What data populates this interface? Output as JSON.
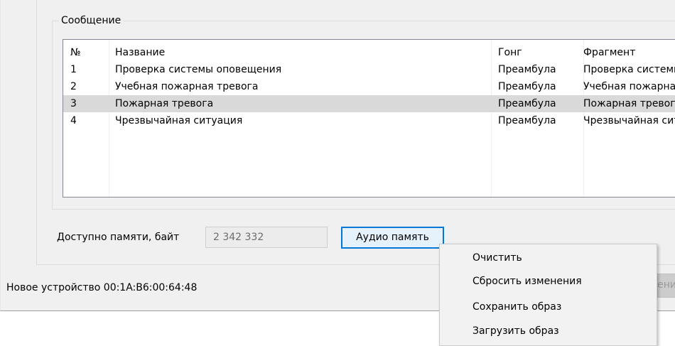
{
  "message_group": {
    "title": "Сообщение",
    "columns": [
      "№",
      "Название",
      "Гонг",
      "Фрагмент"
    ],
    "rows": [
      {
        "num": "1",
        "name": "Проверка системы оповещения",
        "gong": "Преамбула",
        "fragment": "Проверка системы оповещения"
      },
      {
        "num": "2",
        "name": "Учебная пожарная тревога",
        "gong": "Преамбула",
        "fragment": "Учебная пожарная тревога"
      },
      {
        "num": "3",
        "name": "Пожарная тревога",
        "gong": "Преамбула",
        "fragment": "Пожарная тревога",
        "selected": true
      },
      {
        "num": "4",
        "name": "Чрезвычайная ситуация",
        "gong": "Преамбула",
        "fragment": "Чрезвычайная ситуация"
      }
    ]
  },
  "memory": {
    "label": "Доступно памяти, байт",
    "value": "2 342 332",
    "button_label": "Аудио память"
  },
  "status": {
    "device_text": "Новое устройство 00:1A:B6:00:64:48",
    "hidden_button_label": "Применить"
  },
  "context_menu": {
    "items": [
      "Очистить",
      "Сбросить изменения",
      "Сохранить образ",
      "Загрузить образ"
    ]
  },
  "colors": {
    "selection": "#d9d9d9",
    "button_focus_border": "#0078d7",
    "dialog_bg": "#f0f0f0"
  }
}
